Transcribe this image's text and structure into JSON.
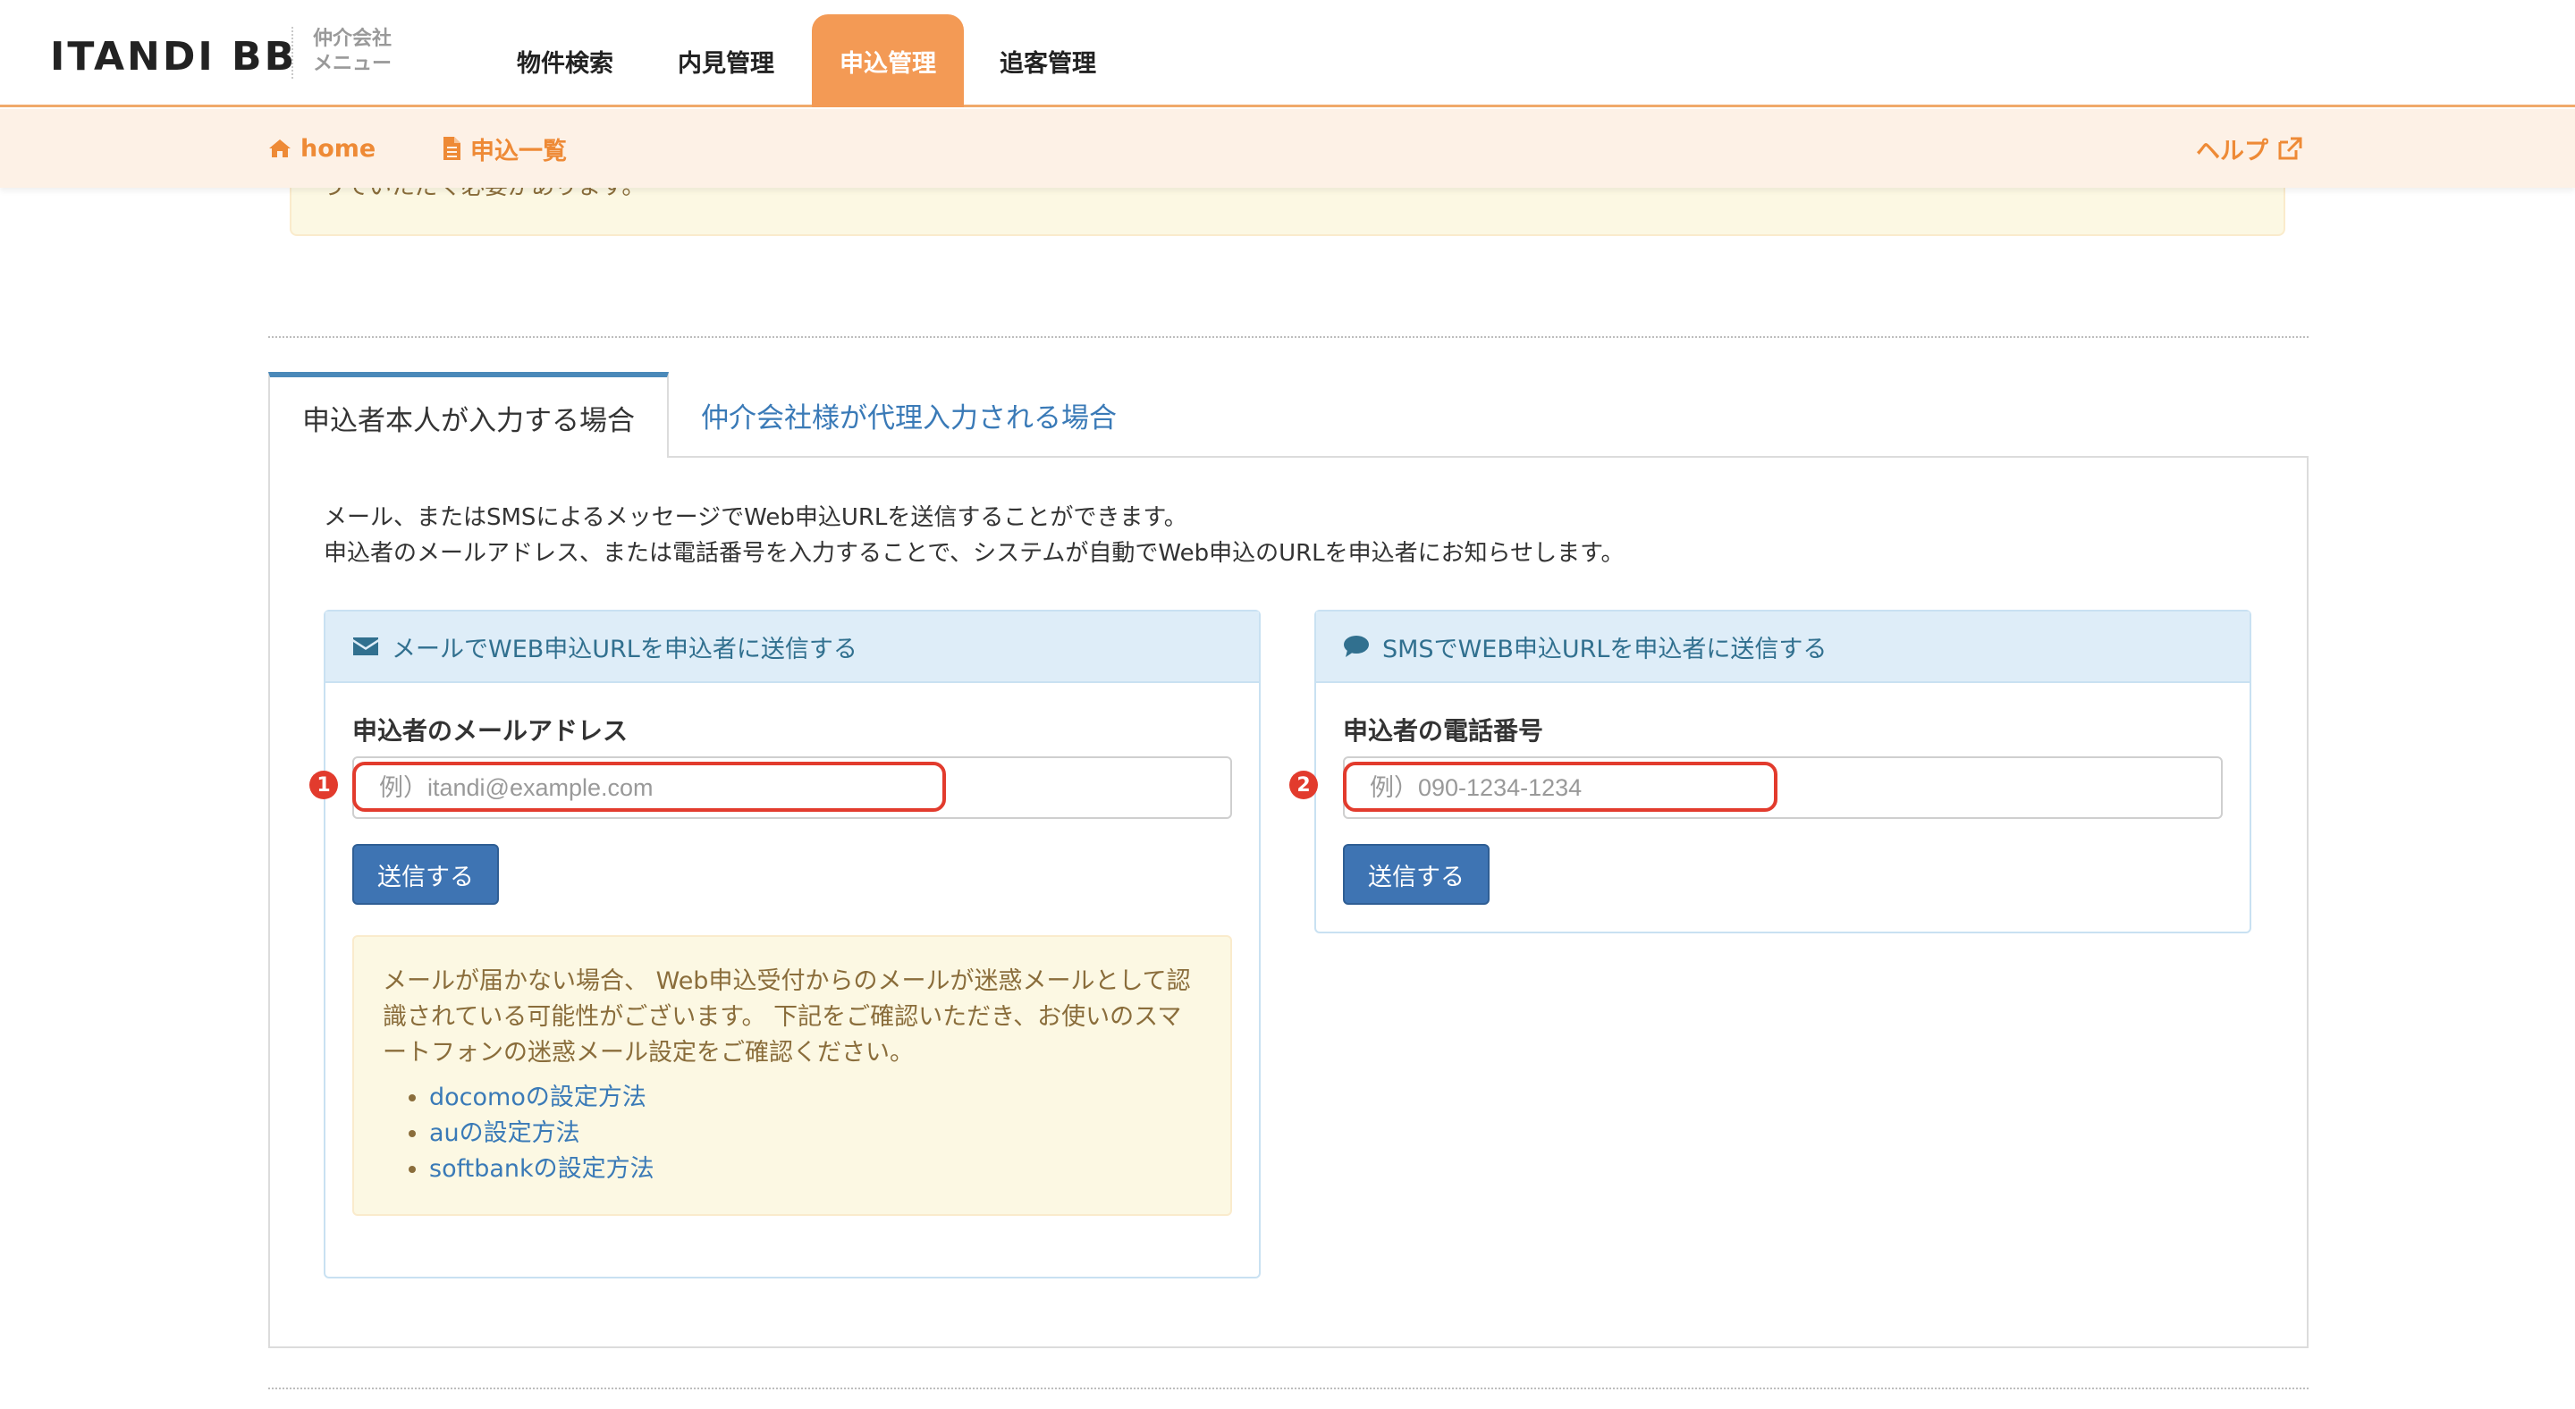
{
  "header": {
    "logo": "ITANDI BB",
    "logo_sub_line1": "仲介会社",
    "logo_sub_line2": "メニュー",
    "nav": [
      {
        "label": "物件検索"
      },
      {
        "label": "内見管理"
      },
      {
        "label": "申込管理",
        "active": true
      },
      {
        "label": "追客管理"
      }
    ]
  },
  "subheader": {
    "home_label": "home",
    "list_label": "申込一覧",
    "help_label": "ヘルプ"
  },
  "alert_remnant": "うていただく必要があります。",
  "tabs": [
    {
      "label": "申込者本人が入力する場合",
      "active": true
    },
    {
      "label": "仲介会社様が代理入力される場合",
      "active": false
    }
  ],
  "description": {
    "line1": "メール、またはSMSによるメッセージでWeb申込URLを送信することができます。",
    "line2": "申込者のメールアドレス、または電話番号を入力することで、システムが自動でWeb申込のURLを申込者にお知らせします。"
  },
  "email_card": {
    "title": "メールでWEB申込URLを申込者に送信する",
    "icon": "envelope-icon",
    "label": "申込者のメールアドレス",
    "placeholder": "例）itandi@example.com",
    "value": "",
    "badge": "1",
    "button_label": "送信する",
    "warning": {
      "text": "メールが届かない場合、 Web申込受付からのメールが迷惑メールとして認識されている可能性がございます。 下記をご確認いただき、お使いのスマートフォンの迷惑メール設定をご確認ください。",
      "links": [
        {
          "label": "docomoの設定方法"
        },
        {
          "label": "auの設定方法"
        },
        {
          "label": "softbankの設定方法"
        }
      ]
    }
  },
  "sms_card": {
    "title": "SMSでWEB申込URLを申込者に送信する",
    "icon": "comment-icon",
    "label": "申込者の電話番号",
    "placeholder": "例）090-1234-1234",
    "value": "",
    "badge": "2",
    "button_label": "送信する"
  },
  "colors": {
    "accent_orange": "#f39a55",
    "link_blue": "#3a7ab7",
    "button_blue": "#3e74b3",
    "highlight_red": "#e23b2d"
  }
}
